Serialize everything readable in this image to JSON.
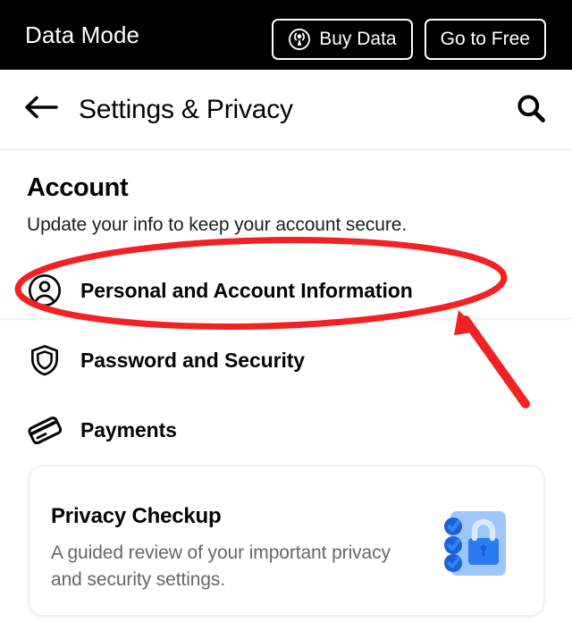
{
  "data_bar": {
    "title": "Data Mode",
    "buy_button": {
      "label": "Buy Data",
      "icon": "broadcast-icon"
    },
    "free_button": {
      "label": "Go to Free"
    }
  },
  "nav": {
    "back_icon": "back-arrow-icon",
    "title": "Settings & Privacy",
    "search_icon": "search-icon"
  },
  "account_section": {
    "heading": "Account",
    "subheading": "Update your info to keep your account secure.",
    "items": [
      {
        "label": "Personal and Account Information",
        "icon": "person-circle-icon"
      },
      {
        "label": "Password and Security",
        "icon": "shield-icon"
      },
      {
        "label": "Payments",
        "icon": "credit-card-icon"
      }
    ]
  },
  "privacy_checkup": {
    "title": "Privacy Checkup",
    "description": "A guided review of your important privacy and security settings.",
    "illustration": "lock-checklist-icon"
  },
  "annotation": {
    "type": "red-ellipse-and-arrow",
    "target": "Personal and Account Information",
    "color": "#F22222"
  },
  "colors": {
    "bar_background": "#000000",
    "page_background": "#ffffff",
    "primary_text": "#050505",
    "secondary_text": "#65676b",
    "divider": "#e4e6eb",
    "annotation_red": "#F22222",
    "illustration_panel": "#9DC7FB",
    "illustration_lock": "#2B7BF3",
    "illustration_check": "#1B62D6"
  }
}
